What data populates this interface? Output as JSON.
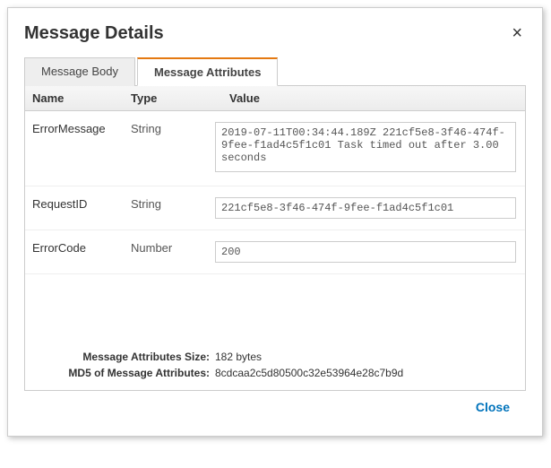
{
  "dialog": {
    "title": "Message Details",
    "close_x": "×"
  },
  "tabs": {
    "body": "Message Body",
    "attributes": "Message Attributes"
  },
  "headers": {
    "name": "Name",
    "type": "Type",
    "value": "Value"
  },
  "rows": [
    {
      "name": "ErrorMessage",
      "type": "String",
      "value": "2019-07-11T00:34:44.189Z 221cf5e8-3f46-474f-9fee-f1ad4c5f1c01 Task timed out after 3.00 seconds",
      "multi": true
    },
    {
      "name": "RequestID",
      "type": "String",
      "value": "221cf5e8-3f46-474f-9fee-f1ad4c5f1c01",
      "multi": false
    },
    {
      "name": "ErrorCode",
      "type": "Number",
      "value": "200",
      "multi": false
    }
  ],
  "info": {
    "size_label": "Message Attributes Size:",
    "size_value": "182 bytes",
    "md5_label": "MD5 of Message Attributes:",
    "md5_value": "8cdcaa2c5d80500c32e53964e28c7b9d"
  },
  "footer": {
    "close": "Close"
  }
}
